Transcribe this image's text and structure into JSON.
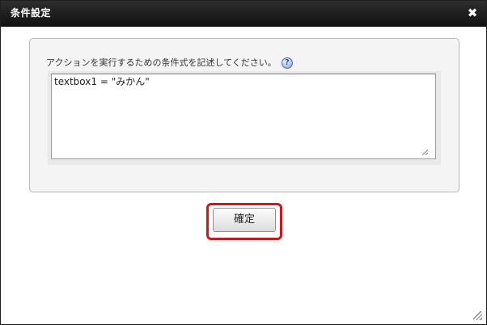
{
  "dialog": {
    "title": "条件設定",
    "close_glyph": "✖",
    "close_icon": "close-icon"
  },
  "form": {
    "prompt": "アクションを実行するための条件式を記述してください。",
    "help_glyph": "?",
    "help_icon": "help-icon",
    "condition_value": "textbox1 = \"みかん\""
  },
  "actions": {
    "confirm_label": "確定",
    "highlight_color": "#d3141a"
  }
}
